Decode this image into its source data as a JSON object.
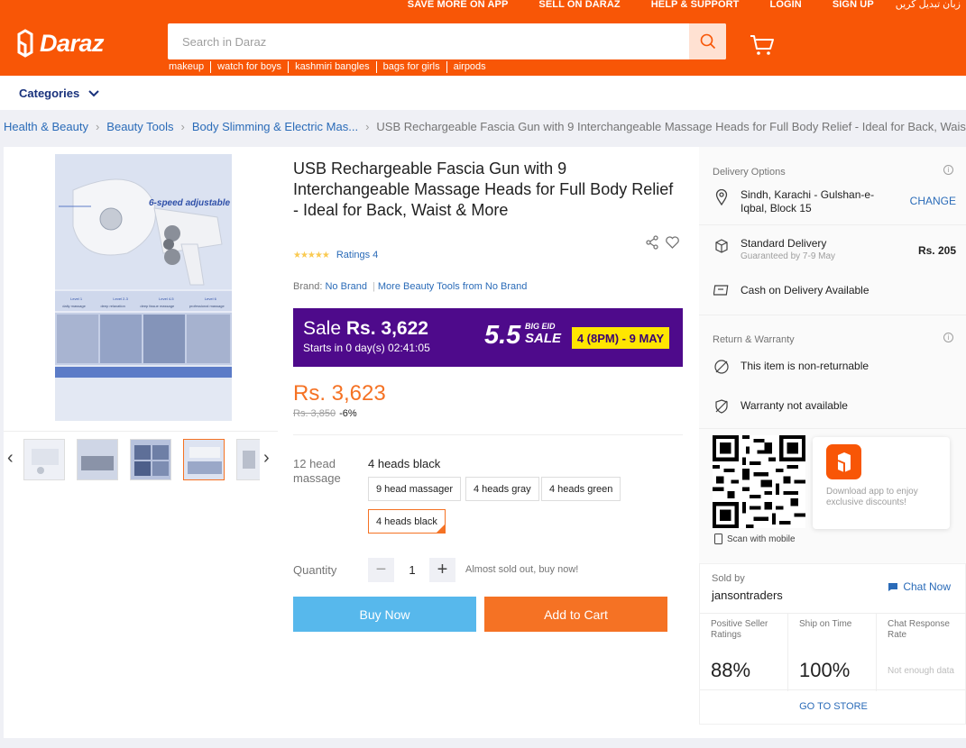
{
  "topnav": {
    "save_more": "SAVE MORE ON APP",
    "sell": "SELL ON DARAZ",
    "help": "HELP & SUPPORT",
    "login": "LOGIN",
    "signup": "SIGN UP",
    "language": "زبان تبدیل کریں"
  },
  "logo": {
    "text": "Daraz"
  },
  "search": {
    "placeholder": "Search in Daraz",
    "icon": "search-icon"
  },
  "suggestions": [
    "makeup",
    "watch for boys",
    "kashmiri bangles",
    "bags for girls",
    "airpods"
  ],
  "categories": {
    "label": "Categories"
  },
  "breadcrumb": [
    "Health & Beauty",
    "Beauty Tools",
    "Body Slimming & Electric Mas...",
    "USB Rechargeable Fascia Gun with 9 Interchangeable Massage Heads for Full Body Relief - Ideal for Back, Waist &"
  ],
  "gallery": {
    "image_heading": "6-speed adjustable",
    "levels": [
      "Level 1",
      "Level 2-3",
      "Level 4-5",
      "Level 6"
    ],
    "level_names": [
      "daily massage",
      "deep relaxation",
      "deep tissue massage",
      "professional massage"
    ],
    "selected_thumb": 3
  },
  "product": {
    "title": "USB Rechargeable Fascia Gun with 9 Interchangeable Massage Heads for Full Body Relief - Ideal for Back, Waist & More",
    "ratings": "Ratings 4",
    "stars": "★★★★★",
    "brand_label": "Brand:",
    "brand": "No Brand",
    "more_from": "More Beauty Tools from No Brand",
    "sale": {
      "label": "Sale",
      "price": "Rs. 3,622",
      "timer": "Starts in 0 day(s) 02:41:05",
      "event_num": "5.5",
      "event_big": "BIG EID",
      "event_sale": "SALE",
      "time_range": "4 (8PM) - 9 MAY"
    },
    "price": "Rs. 3,623",
    "old_price": "Rs. 3,850",
    "discount": "-6%",
    "variation_label": "12 head massage",
    "variation_selected": "4 heads black",
    "options": [
      "9 head massager",
      "4 heads gray",
      "4 heads green",
      "4 heads black"
    ],
    "quantity_label": "Quantity",
    "quantity": "1",
    "quantity_note": "Almost sold out, buy now!",
    "buy_now": "Buy Now",
    "add_to_cart": "Add to Cart"
  },
  "delivery": {
    "heading": "Delivery Options",
    "location": "Sindh, Karachi - Gulshan-e-Iqbal, Block 15",
    "change": "CHANGE",
    "standard": "Standard Delivery",
    "guarantee": "Guaranteed by 7-9 May",
    "fee": "Rs. 205",
    "cod": "Cash on Delivery Available"
  },
  "warranty": {
    "heading": "Return & Warranty",
    "returnable": "This item is non-returnable",
    "warranty": "Warranty not available"
  },
  "app": {
    "text": "Download app to enjoy exclusive discounts!",
    "scan": "Scan with mobile"
  },
  "seller": {
    "sold_by": "Sold by",
    "name": "jansontraders",
    "chat": "Chat Now",
    "metrics": [
      {
        "label": "Positive Seller Ratings",
        "value": "88%"
      },
      {
        "label": "Ship on Time",
        "value": "100%"
      },
      {
        "label": "Chat Response Rate",
        "value": "Not enough data"
      }
    ],
    "go_to_store": "GO TO STORE"
  },
  "colors": {
    "brand": "#f85606",
    "accent": "#f57224",
    "link": "#2a6bb8",
    "sale_banner": "#4e0a8b",
    "buy_button": "#57b8ec"
  }
}
